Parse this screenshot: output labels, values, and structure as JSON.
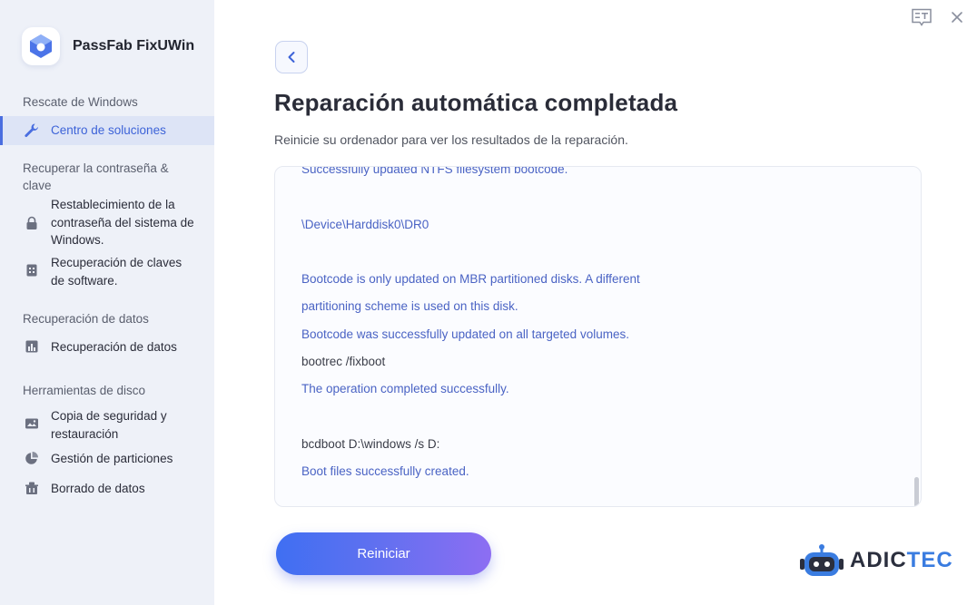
{
  "app": {
    "name": "PassFab FixUWin"
  },
  "sidebar": {
    "sections": [
      {
        "title": "Rescate de Windows",
        "items": [
          {
            "label": "Centro de soluciones",
            "icon": "wrench-icon",
            "active": true
          }
        ]
      },
      {
        "title": "Recuperar la contraseña & clave",
        "items": [
          {
            "label": "Restablecimiento de la contraseña del sistema de Windows.",
            "icon": "lock-icon"
          },
          {
            "label": "Recuperación de claves de software.",
            "icon": "key-document-icon"
          }
        ]
      },
      {
        "title": "Recuperación de datos",
        "items": [
          {
            "label": "Recuperación de datos",
            "icon": "bar-chart-icon"
          }
        ]
      },
      {
        "title": "Herramientas de disco",
        "items": [
          {
            "label": "Copia de seguridad y restauración",
            "icon": "image-backup-icon"
          },
          {
            "label": "Gestión de particiones",
            "icon": "pie-chart-icon"
          },
          {
            "label": "Borrado de datos",
            "icon": "erase-icon"
          }
        ]
      }
    ]
  },
  "main": {
    "title": "Reparación automática completada",
    "subtitle": "Reinicie su ordenador para ver los resultados de la reparación.",
    "log": [
      {
        "text": "Successfully updated NTFS filesystem bootcode.",
        "style": "cut"
      },
      {
        "text": "",
        "style": "blue"
      },
      {
        "text": "\\Device\\Harddisk0\\DR0",
        "style": "blue"
      },
      {
        "text": "",
        "style": "blue"
      },
      {
        "text": "Bootcode is only updated on MBR partitioned disks.  A different",
        "style": "blue"
      },
      {
        "text": "partitioning scheme is used on this disk.",
        "style": "blue"
      },
      {
        "text": "Bootcode was successfully updated on all targeted volumes.",
        "style": "blue"
      },
      {
        "text": "bootrec /fixboot",
        "style": "dark"
      },
      {
        "text": "The operation completed successfully.",
        "style": "blue"
      },
      {
        "text": "",
        "style": "blue"
      },
      {
        "text": "bcdboot D:\\windows /s D:",
        "style": "dark"
      },
      {
        "text": "Boot files successfully created.",
        "style": "blue"
      }
    ],
    "restart_label": "Reiniciar"
  },
  "watermark": {
    "text_a": "ADIC",
    "text_b": "TEC"
  },
  "colors": {
    "accent": "#3d63d8",
    "sidebar_bg": "#eef1f8",
    "log_blue": "#4a63c4",
    "watermark_dark": "#2b2f3e",
    "watermark_blue": "#3a7ce0"
  }
}
